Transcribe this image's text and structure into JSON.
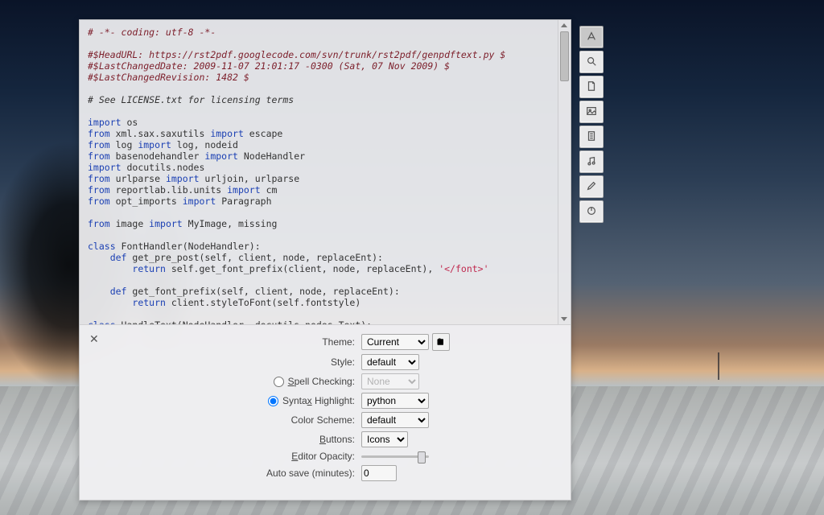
{
  "desktop": {},
  "editor": {
    "code_lines": [
      {
        "spans": [
          {
            "cls": "c-meta",
            "t": "# -*- coding: utf-8 -*-"
          }
        ]
      },
      {
        "spans": []
      },
      {
        "spans": [
          {
            "cls": "c-meta",
            "t": "#$HeadURL: https://rst2pdf.googlecode.com/svn/trunk/rst2pdf/genpdftext.py $"
          }
        ]
      },
      {
        "spans": [
          {
            "cls": "c-meta",
            "t": "#$LastChangedDate: 2009-11-07 21:01:17 -0300 (Sat, 07 Nov 2009) $"
          }
        ]
      },
      {
        "spans": [
          {
            "cls": "c-meta",
            "t": "#$LastChangedRevision: 1482 $"
          }
        ]
      },
      {
        "spans": []
      },
      {
        "spans": [
          {
            "cls": "c-comment",
            "t": "# See LICENSE.txt for licensing terms"
          }
        ]
      },
      {
        "spans": []
      },
      {
        "spans": [
          {
            "cls": "c-kw",
            "t": "import"
          },
          {
            "cls": "",
            "t": " os"
          }
        ]
      },
      {
        "spans": [
          {
            "cls": "c-kw",
            "t": "from"
          },
          {
            "cls": "",
            "t": " xml.sax.saxutils "
          },
          {
            "cls": "c-kw",
            "t": "import"
          },
          {
            "cls": "",
            "t": " escape"
          }
        ]
      },
      {
        "spans": [
          {
            "cls": "c-kw",
            "t": "from"
          },
          {
            "cls": "",
            "t": " log "
          },
          {
            "cls": "c-kw",
            "t": "import"
          },
          {
            "cls": "",
            "t": " log, nodeid"
          }
        ]
      },
      {
        "spans": [
          {
            "cls": "c-kw",
            "t": "from"
          },
          {
            "cls": "",
            "t": " basenodehandler "
          },
          {
            "cls": "c-kw",
            "t": "import"
          },
          {
            "cls": "",
            "t": " NodeHandler"
          }
        ]
      },
      {
        "spans": [
          {
            "cls": "c-kw",
            "t": "import"
          },
          {
            "cls": "",
            "t": " docutils.nodes"
          }
        ]
      },
      {
        "spans": [
          {
            "cls": "c-kw",
            "t": "from"
          },
          {
            "cls": "",
            "t": " urlparse "
          },
          {
            "cls": "c-kw",
            "t": "import"
          },
          {
            "cls": "",
            "t": " urljoin, urlparse"
          }
        ]
      },
      {
        "spans": [
          {
            "cls": "c-kw",
            "t": "from"
          },
          {
            "cls": "",
            "t": " reportlab.lib.units "
          },
          {
            "cls": "c-kw",
            "t": "import"
          },
          {
            "cls": "",
            "t": " cm"
          }
        ]
      },
      {
        "spans": [
          {
            "cls": "c-kw",
            "t": "from"
          },
          {
            "cls": "",
            "t": " opt_imports "
          },
          {
            "cls": "c-kw",
            "t": "import"
          },
          {
            "cls": "",
            "t": " Paragraph"
          }
        ]
      },
      {
        "spans": []
      },
      {
        "spans": [
          {
            "cls": "c-kw",
            "t": "from"
          },
          {
            "cls": "",
            "t": " image "
          },
          {
            "cls": "c-kw",
            "t": "import"
          },
          {
            "cls": "",
            "t": " MyImage, missing"
          }
        ]
      },
      {
        "spans": []
      },
      {
        "spans": [
          {
            "cls": "c-kw",
            "t": "class"
          },
          {
            "cls": "",
            "t": " FontHandler(NodeHandler):"
          }
        ]
      },
      {
        "spans": [
          {
            "cls": "",
            "t": "    "
          },
          {
            "cls": "c-kw",
            "t": "def"
          },
          {
            "cls": "",
            "t": " get_pre_post(self, client, node, replaceEnt):"
          }
        ]
      },
      {
        "spans": [
          {
            "cls": "",
            "t": "        "
          },
          {
            "cls": "c-kw",
            "t": "return"
          },
          {
            "cls": "",
            "t": " self.get_font_prefix(client, node, replaceEnt), "
          },
          {
            "cls": "c-string",
            "t": "'</font>'"
          }
        ]
      },
      {
        "spans": []
      },
      {
        "spans": [
          {
            "cls": "",
            "t": "    "
          },
          {
            "cls": "c-kw",
            "t": "def"
          },
          {
            "cls": "",
            "t": " get_font_prefix(self, client, node, replaceEnt):"
          }
        ]
      },
      {
        "spans": [
          {
            "cls": "",
            "t": "        "
          },
          {
            "cls": "c-kw",
            "t": "return"
          },
          {
            "cls": "",
            "t": " client.styleToFont(self.fontstyle)"
          }
        ]
      },
      {
        "spans": []
      },
      {
        "spans": [
          {
            "cls": "c-kw",
            "t": "class"
          },
          {
            "cls": "",
            "t": " HandleText(NodeHandler, docutils.nodes.Text):"
          }
        ]
      }
    ]
  },
  "settings": {
    "labels": {
      "theme": "Theme:",
      "style": "Style:",
      "spell": "Spell Checking:",
      "syntax": "Syntax Highlight:",
      "color": "Color Scheme:",
      "buttons": "Buttons:",
      "opacity": "Editor Opacity:",
      "autosave": "Auto save (minutes):"
    },
    "theme": "Current",
    "style": "default",
    "spell_value": "None",
    "syntax": "python",
    "color_scheme": "default",
    "buttons": "Icons",
    "autosave": "0",
    "mode": "syntax"
  },
  "toolbar": {
    "items": [
      {
        "name": "font-icon",
        "active": true
      },
      {
        "name": "search-icon",
        "active": false
      },
      {
        "name": "new-file-icon",
        "active": false
      },
      {
        "name": "image-icon",
        "active": false
      },
      {
        "name": "page-icon",
        "active": false
      },
      {
        "name": "music-icon",
        "active": false
      },
      {
        "name": "pencil-icon",
        "active": false
      },
      {
        "name": "power-icon",
        "active": false
      }
    ]
  }
}
